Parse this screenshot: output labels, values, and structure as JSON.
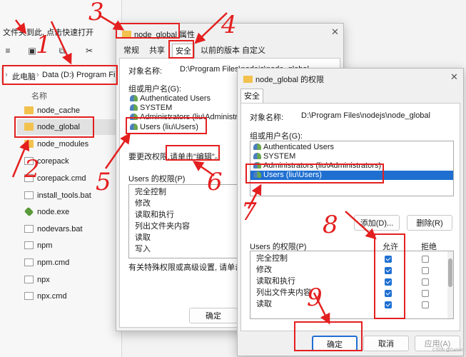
{
  "explorer": {
    "pin_hint": "文件夹到此, 点击快速打开",
    "breadcrumb": [
      "此电脑",
      "Data (D:)",
      "Program Files"
    ],
    "column_header": "名称",
    "items": [
      {
        "label": "node_cache",
        "type": "folder"
      },
      {
        "label": "node_global",
        "type": "folder",
        "selected": true
      },
      {
        "label": "node_modules",
        "type": "folder"
      },
      {
        "label": "corepack",
        "type": "file"
      },
      {
        "label": "corepack.cmd",
        "type": "file"
      },
      {
        "label": "install_tools.bat",
        "type": "file"
      },
      {
        "label": "node.exe",
        "type": "node"
      },
      {
        "label": "nodevars.bat",
        "type": "file"
      },
      {
        "label": "npm",
        "type": "file"
      },
      {
        "label": "npm.cmd",
        "type": "file"
      },
      {
        "label": "npx",
        "type": "file"
      },
      {
        "label": "npx.cmd",
        "type": "file"
      }
    ]
  },
  "properties": {
    "title": "node_global 属性",
    "tabs": [
      "常规",
      "共享",
      "安全",
      "以前的版本",
      "自定义"
    ],
    "active_tab": "安全",
    "object_label": "对象名称:",
    "object_value": "D:\\Program Files\\nodejs\\node_global",
    "group_label": "组或用户名(G):",
    "users": [
      "Authenticated Users",
      "SYSTEM",
      "Administrators (liu\\Administrators)",
      "Users (liu\\Users)"
    ],
    "edit_hint_a": "要更改权限,",
    "edit_hint_b": "请单击\"编辑\"。",
    "perm_label": "Users 的权限(P)",
    "permissions": [
      "完全控制",
      "修改",
      "读取和执行",
      "列出文件夹内容",
      "读取",
      "写入"
    ],
    "special_hint": "有关特殊权限或高级设置, 请单击\"高级",
    "ok": "确定"
  },
  "permissions_dialog": {
    "title": "node_global 的权限",
    "tab": "安全",
    "object_label": "对象名称:",
    "object_value": "D:\\Program Files\\nodejs\\node_global",
    "group_label": "组或用户名(G):",
    "users": [
      "Authenticated Users",
      "SYSTEM",
      "Administrators (liu\\Administrators)",
      "Users (liu\\Users)"
    ],
    "add_button": "添加(D)...",
    "remove_button": "删除(R)",
    "perm_label": "Users 的权限(P)",
    "allow_header": "允许",
    "deny_header": "拒绝",
    "permissions": [
      "完全控制",
      "修改",
      "读取和执行",
      "列出文件夹内容",
      "读取"
    ],
    "allow_checked": [
      true,
      true,
      true,
      true,
      true
    ],
    "deny_checked": [
      false,
      false,
      false,
      false,
      false
    ],
    "ok": "确定",
    "cancel": "取消",
    "apply": "应用(A)"
  },
  "annotations": {
    "steps": [
      "1",
      "2",
      "3",
      "4",
      "5",
      "6",
      "7",
      "8",
      "9"
    ],
    "color": "#e41f1f"
  },
  "watermark": "CSDN @Darker"
}
